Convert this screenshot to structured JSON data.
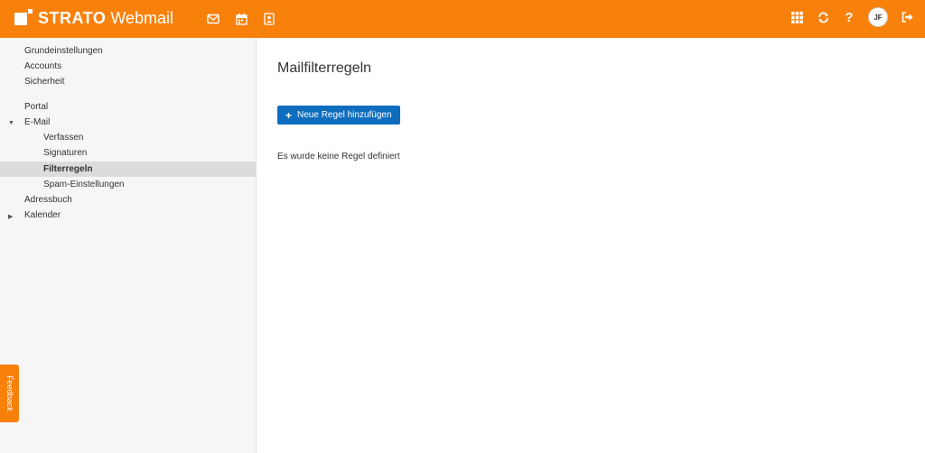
{
  "header": {
    "brand": "STRATO",
    "product": "Webmail",
    "app_icons": [
      "mail-icon",
      "calendar-icon",
      "address-book-icon"
    ],
    "right_icons": [
      "apps-grid-icon",
      "refresh-icon",
      "help-icon"
    ],
    "help_glyph": "?",
    "avatar_initials": "JF",
    "logout_icon": "logout-icon",
    "accent_color": "#f8810c"
  },
  "sidebar": {
    "items": [
      {
        "label": "Grundeinstellungen"
      },
      {
        "label": "Accounts"
      },
      {
        "label": "Sicherheit"
      },
      {
        "label": "Portal"
      },
      {
        "label": "E-Mail",
        "expanded": true
      },
      {
        "label": "Verfassen"
      },
      {
        "label": "Signaturen"
      },
      {
        "label": "Filterregeln",
        "active": true
      },
      {
        "label": "Spam-Einstellungen"
      },
      {
        "label": "Adressbuch"
      },
      {
        "label": "Kalender",
        "expanded": false
      }
    ]
  },
  "feedback_label": "Feedback",
  "main": {
    "title": "Mailfilterregeln",
    "add_button_label": "Neue Regel hinzufügen",
    "add_button_color": "#0f6dbf",
    "empty_message": "Es wurde keine Regel definiert"
  }
}
